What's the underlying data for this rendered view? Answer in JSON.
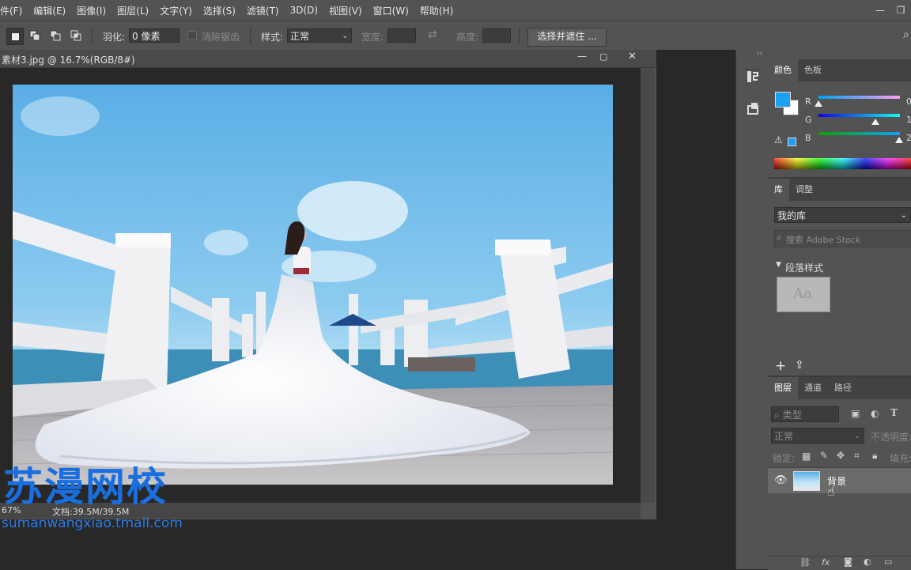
{
  "menubar": {
    "items": [
      "件(F)",
      "编辑(E)",
      "图像(I)",
      "图层(L)",
      "文字(Y)",
      "选择(S)",
      "滤镜(T)",
      "3D(D)",
      "视图(V)",
      "窗口(W)",
      "帮助(H)"
    ]
  },
  "options": {
    "feather_label": "羽化:",
    "feather_value": "0 像素",
    "antialias_label": "消除锯齿",
    "style_label": "样式:",
    "style_value": "正常",
    "width_label": "宽度:",
    "height_label": "高度:",
    "select_mask_button": "选择并遮住 ..."
  },
  "document": {
    "title": "素材3.jpg @ 16.7%(RGB/8#)",
    "zoom": "67%",
    "doc_size": "文档:39.5M/39.5M"
  },
  "watermark": {
    "title": "苏漫网校",
    "url": "sumanwangxiao.tmall.com"
  },
  "color_panel": {
    "tabs": [
      "颜色",
      "色板"
    ],
    "channels": [
      {
        "label": "R",
        "value": "0",
        "level": 0.0
      },
      {
        "label": "G",
        "value": "1",
        "level": 0.7
      },
      {
        "label": "B",
        "value": "2",
        "level": 0.99
      }
    ],
    "foreground": "#1ea0ef",
    "background": "#ffffff"
  },
  "library_panel": {
    "tabs": [
      "库",
      "调整"
    ],
    "library_select": "我的库",
    "search_placeholder": "搜索 Adobe Stock",
    "section_title": "段落样式",
    "thumb_text": "Aa"
  },
  "layers_panel": {
    "tabs": [
      "图层",
      "通道",
      "路径"
    ],
    "filter_kind": "类型",
    "blend_mode": "正常",
    "opacity_label": "不透明度:",
    "lock_label": "锁定:",
    "fill_label": "填充:",
    "layers": [
      {
        "name": "背景"
      }
    ]
  },
  "colors": {
    "chrome": "#535353",
    "dark": "#282828",
    "accent": "#1ea0ef"
  }
}
